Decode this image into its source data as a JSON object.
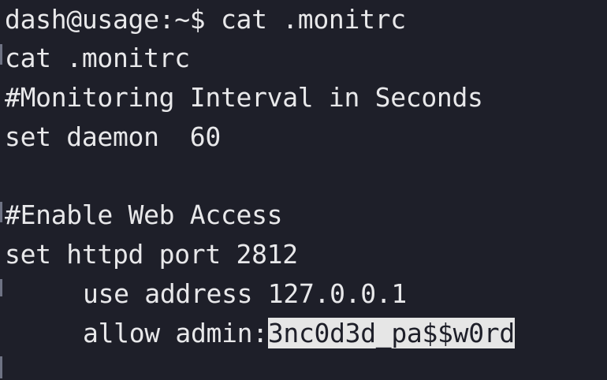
{
  "terminal": {
    "prompt": "dash@usage:~$",
    "command": " cat .monitrc",
    "lines": [
      "cat .monitrc",
      "#Monitoring Interval in Seconds",
      "set daemon  60",
      "",
      "#Enable Web Access",
      "set httpd port 2812",
      "use address 127.0.0.1",
      "allow admin:"
    ],
    "selected_text": "3nc0d3d_pa$$w0rd"
  },
  "colors": {
    "background": "#1e1f29",
    "text": "#e8e8ea",
    "selection_bg": "#e6e6e6",
    "selection_fg": "#1e1f29"
  }
}
